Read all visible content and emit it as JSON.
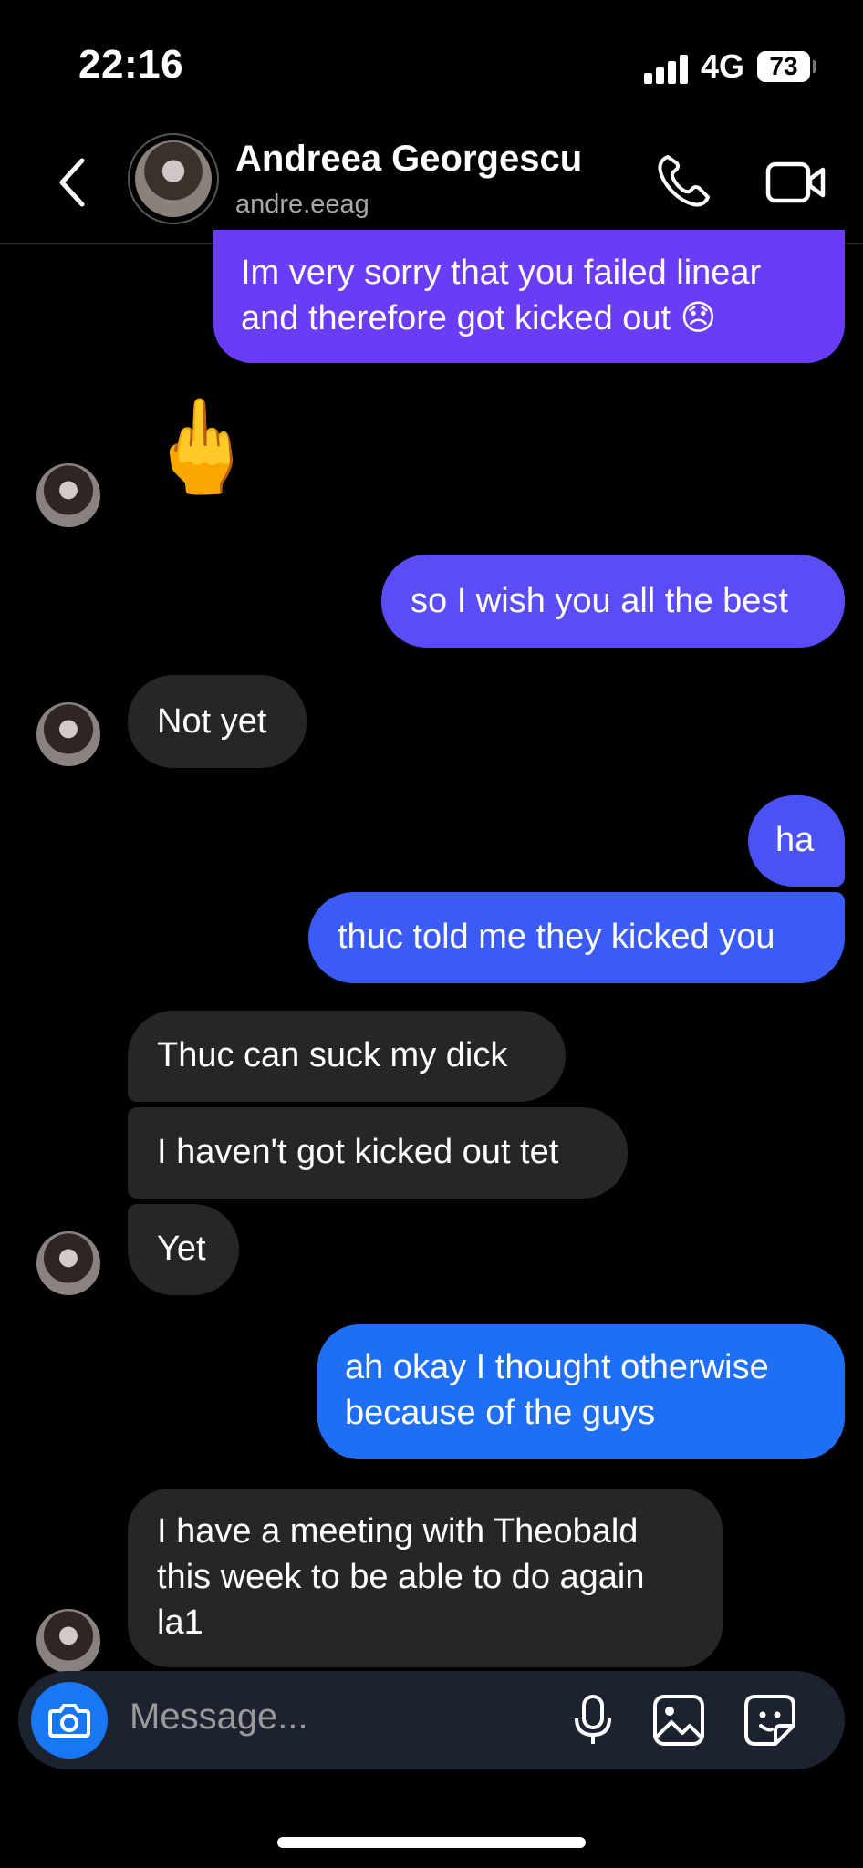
{
  "status_bar": {
    "time": "22:16",
    "network": "4G",
    "battery": "73"
  },
  "header": {
    "name": "Andreea Georgescu",
    "handle": "andre.eeag"
  },
  "colors": {
    "out_purple": "#6a3cf5",
    "out_violet": "#5b4cf6",
    "out_blue": "#3b5bf6",
    "out_bright": "#1f6ff5",
    "in_bubble": "#262626"
  },
  "messages": [
    {
      "side": "out",
      "text": "Im very sorry that you failed linear and therefore got kicked out 😞"
    },
    {
      "side": "in",
      "text": "🖕",
      "kind": "emoji"
    },
    {
      "side": "out",
      "text": "so I wish you all the best"
    },
    {
      "side": "in",
      "text": "Not yet"
    },
    {
      "side": "out",
      "text": "ha"
    },
    {
      "side": "out",
      "text": "thuc told me they kicked you"
    },
    {
      "side": "in",
      "text": "Thuc can suck my dick"
    },
    {
      "side": "in",
      "text": "I haven't got kicked out tet"
    },
    {
      "side": "in",
      "text": "Yet"
    },
    {
      "side": "out",
      "text": "ah okay I thought otherwise because of the guys"
    },
    {
      "side": "in",
      "text": "I have a meeting with Theobald this week to be able to do again la1"
    }
  ],
  "composer": {
    "placeholder": "Message..."
  },
  "icons": {
    "back": "chevron-left-icon",
    "call": "phone-icon",
    "video": "video-camera-icon",
    "camera": "camera-icon",
    "mic": "microphone-icon",
    "gallery": "image-icon",
    "sticker": "sticker-icon"
  }
}
